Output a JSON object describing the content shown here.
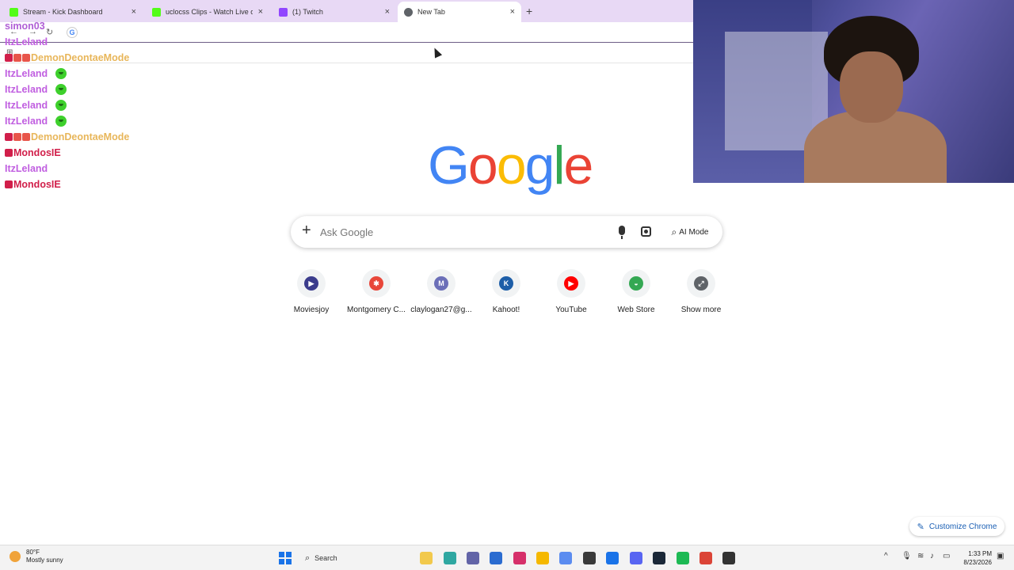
{
  "browser": {
    "tabs": [
      {
        "title": "Stream - Kick Dashboard",
        "favicon_color": "#53fc18",
        "active": false
      },
      {
        "title": "uclocss Clips - Watch Live on Kick",
        "favicon_color": "#53fc18",
        "active": false
      },
      {
        "title": "(1) Twitch",
        "favicon_color": "#9146ff",
        "active": false
      },
      {
        "title": "New Tab",
        "favicon_color": "#5f6368",
        "active": true
      }
    ],
    "new_tab_symbol": "+",
    "close_symbol": "×"
  },
  "chat": [
    {
      "user": "simon03",
      "color": "#b05fd6",
      "text": "",
      "emote": false
    },
    {
      "user": "ItzLeland",
      "color": "#c05ee0",
      "text": "",
      "emote": false
    },
    {
      "user": "DemonDeontaeMode",
      "color": "#e8b65a",
      "text": "",
      "emote": false
    },
    {
      "user": "ItzLeland",
      "color": "#c05ee0",
      "text": "",
      "emote": true
    },
    {
      "user": "ItzLeland",
      "color": "#c05ee0",
      "text": "",
      "emote": true
    },
    {
      "user": "ItzLeland",
      "color": "#c05ee0",
      "text": "",
      "emote": true
    },
    {
      "user": "ItzLeland",
      "color": "#c05ee0",
      "text": "",
      "emote": true
    },
    {
      "user": "DemonDeontaeMode",
      "color": "#e8b65a",
      "text": "",
      "emote": false
    },
    {
      "user": "MondosIE",
      "color": "#d11f4a",
      "text": "",
      "emote": false
    },
    {
      "user": "ItzLeland",
      "color": "#c05ee0",
      "text": "",
      "emote": false
    },
    {
      "user": "MondosIE",
      "color": "#d11f4a",
      "text": "",
      "emote": false
    }
  ],
  "google": {
    "logo_letters": [
      {
        "ch": "G",
        "color": "#4285f4"
      },
      {
        "ch": "o",
        "color": "#ea4335"
      },
      {
        "ch": "o",
        "color": "#fbbc05"
      },
      {
        "ch": "g",
        "color": "#4285f4"
      },
      {
        "ch": "l",
        "color": "#34a853"
      },
      {
        "ch": "e",
        "color": "#ea4335"
      }
    ],
    "search_placeholder": "Ask Google",
    "ai_mode_label": "AI Mode",
    "shortcuts": [
      {
        "label": "Moviesjoy",
        "icon": "film-icon",
        "color": "#3b3c8c",
        "glyph": "▶"
      },
      {
        "label": "Montgomery C...",
        "icon": "montgomery-logo-icon",
        "color": "#e8473a",
        "glyph": "✱"
      },
      {
        "label": "claylogan27@g...",
        "icon": "avatar-m-icon",
        "color": "#6b6fb8",
        "glyph": "M"
      },
      {
        "label": "Kahoot!",
        "icon": "kahoot-k-icon",
        "color": "#1d5ea8",
        "glyph": "K"
      },
      {
        "label": "YouTube",
        "icon": "youtube-icon",
        "color": "#ff0000",
        "glyph": "▶"
      },
      {
        "label": "Web Store",
        "icon": "web-store-icon",
        "color": "#34a853",
        "glyph": "◒"
      },
      {
        "label": "Show more",
        "icon": "expand-icon",
        "color": "#5f6368",
        "glyph": "⤢"
      }
    ],
    "customize_label": "Customize Chrome"
  },
  "taskbar": {
    "weather_temp": "80°F",
    "weather_desc": "Mostly sunny",
    "search_label": "Search",
    "time": "1:33 PM",
    "date": "8/23/2026",
    "apps": [
      {
        "icon": "file-explorer-icon",
        "color": "#f2c94c"
      },
      {
        "icon": "edge-icon",
        "color": "#2fa7a1"
      },
      {
        "icon": "teams-icon",
        "color": "#6264a7"
      },
      {
        "icon": "store-icon",
        "color": "#2b6cd0"
      },
      {
        "icon": "instagram-icon",
        "color": "#d6306a"
      },
      {
        "icon": "folder-icon",
        "color": "#f5b800"
      },
      {
        "icon": "copilot-icon",
        "color": "#5b8cf0"
      },
      {
        "icon": "obs-icon",
        "color": "#3a3a3a"
      },
      {
        "icon": "chrome-icon",
        "color": "#1a73e8"
      },
      {
        "icon": "discord-icon",
        "color": "#5865f2"
      },
      {
        "icon": "steam-icon",
        "color": "#1b2838"
      },
      {
        "icon": "spotify-icon",
        "color": "#1db954"
      },
      {
        "icon": "chrome-active-icon",
        "color": "#db4437"
      },
      {
        "icon": "app-icon",
        "color": "#333333"
      }
    ]
  }
}
